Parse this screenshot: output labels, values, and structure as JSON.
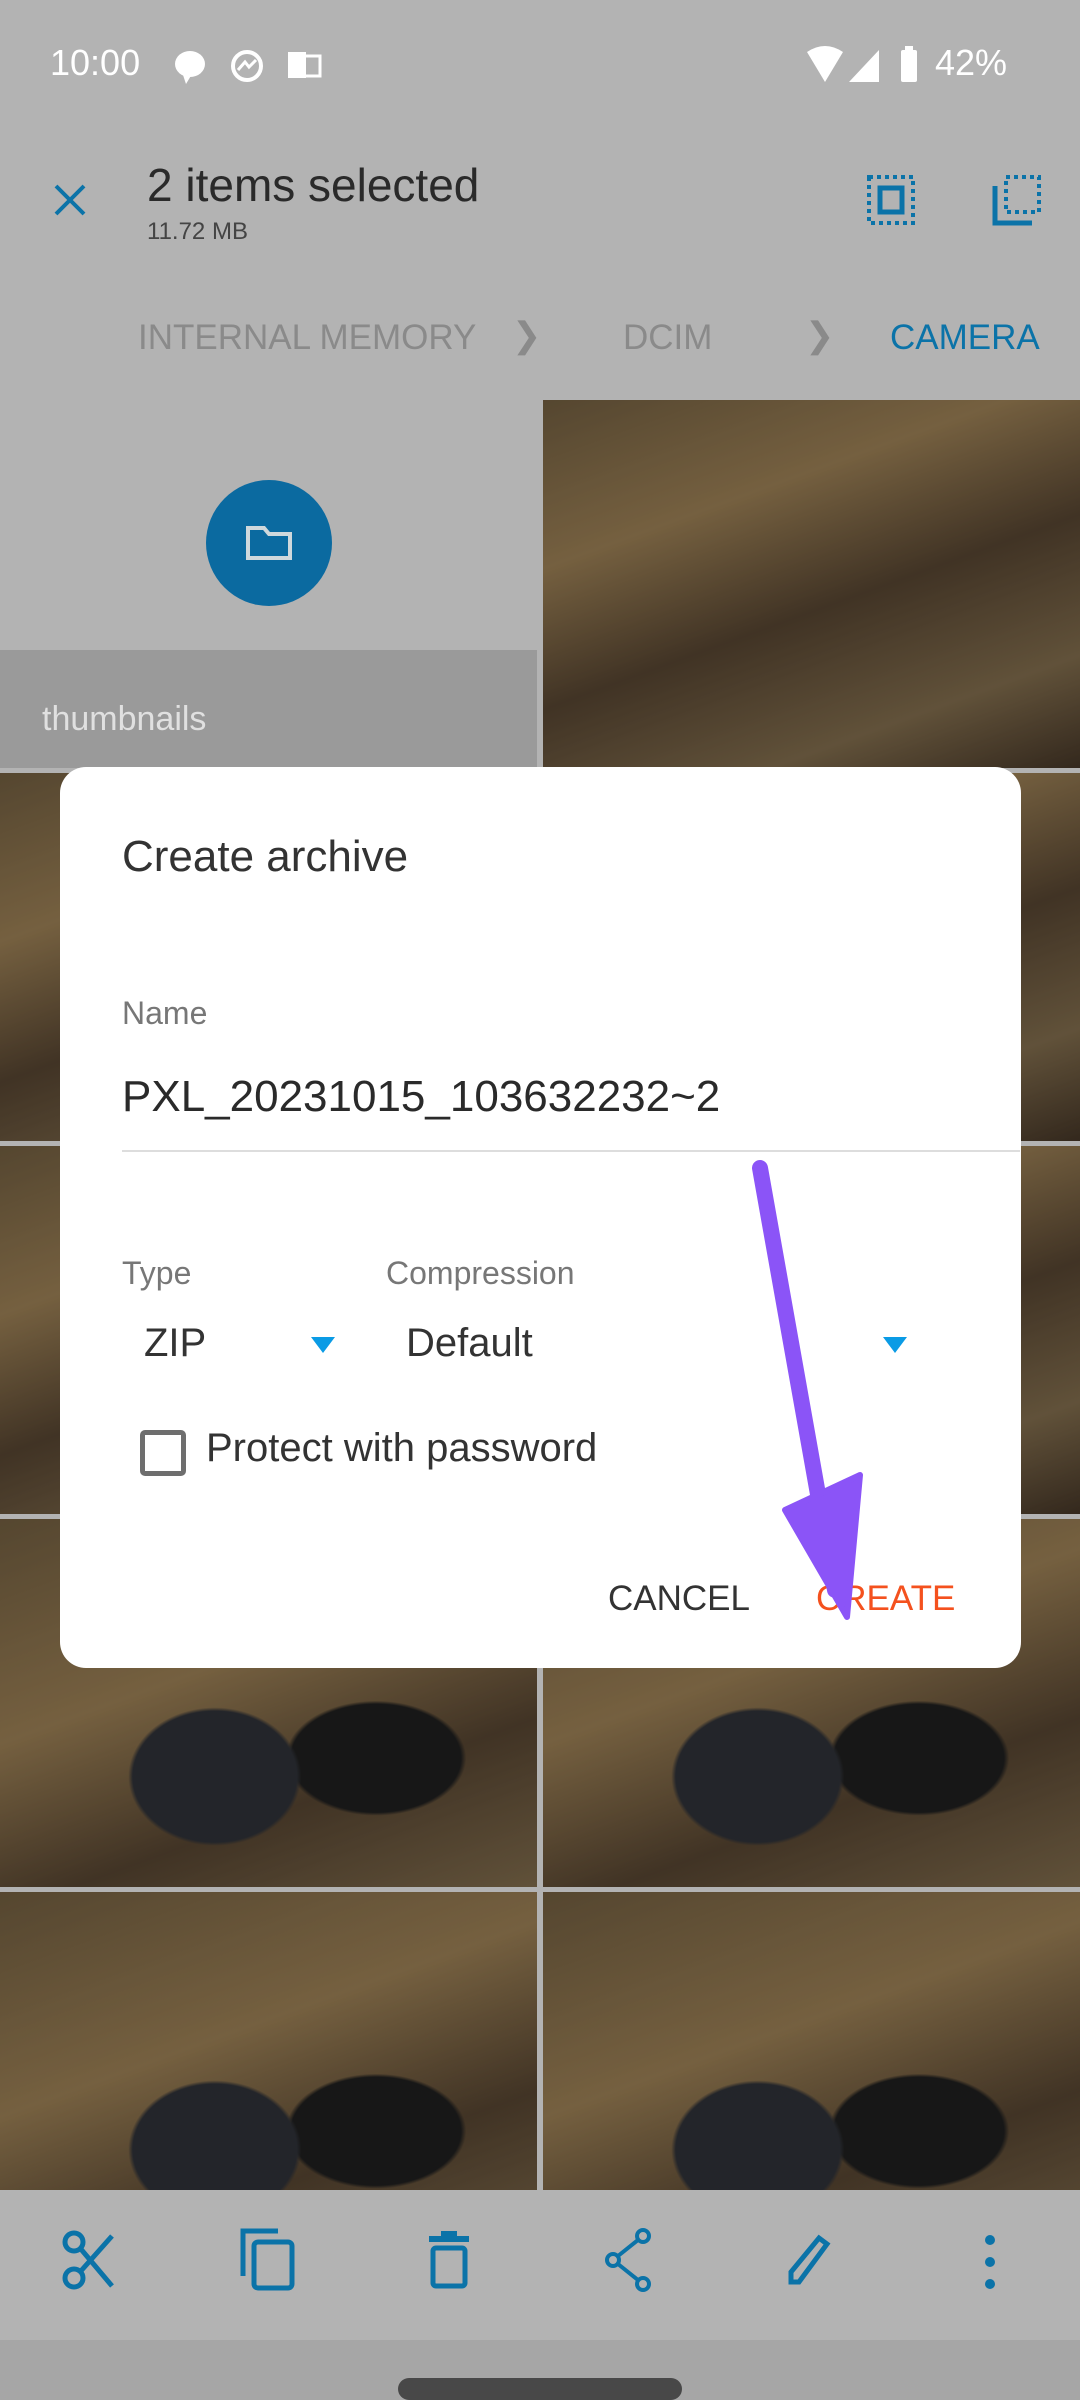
{
  "status_bar": {
    "time": "10:00",
    "battery": "42%",
    "icons": [
      "chat-bubble-icon",
      "messenger-icon",
      "outlook-icon",
      "wifi-icon",
      "signal-icon",
      "battery-icon"
    ]
  },
  "toolbar": {
    "title": "2 items selected",
    "subtitle": "11.72 MB",
    "icons": [
      "close-icon",
      "select-all-icon",
      "select-range-icon"
    ]
  },
  "breadcrumb": [
    {
      "label": "INTERNAL MEMORY"
    },
    {
      "label": "DCIM"
    },
    {
      "label": "CAMERA"
    }
  ],
  "grid": {
    "folder": {
      "label": "thumbnails"
    }
  },
  "dialog": {
    "title": "Create archive",
    "name_label": "Name",
    "name_value": "PXL_20231015_103632232~2",
    "type_label": "Type",
    "type_value": "ZIP",
    "compression_label": "Compression",
    "compression_value": "Default",
    "password_label": "Protect with password",
    "password_checked": false,
    "cancel": "CANCEL",
    "create": "CREATE"
  },
  "bottom_bar": [
    "cut-icon",
    "copy-icon",
    "delete-icon",
    "share-icon",
    "rename-icon",
    "more-icon"
  ],
  "colors": {
    "accent": "#0b73a8",
    "create": "#f4511e",
    "arrow": "#8b54f7",
    "dropdown": "#0a9be5"
  }
}
